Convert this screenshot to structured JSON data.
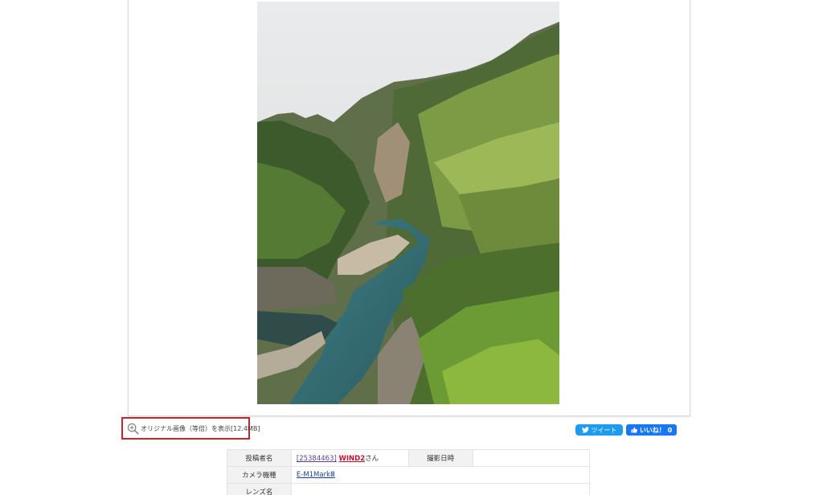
{
  "photo": {
    "description_icon": "landscape-photo"
  },
  "original_link": {
    "label": "オリジナル画像（等倍）を表示[12.4MB]",
    "icon": "zoom-in-icon"
  },
  "social": {
    "tweet_label": "ツイート",
    "like_label": "いいね！ 0"
  },
  "info_table": {
    "poster_header": "投稿者名",
    "poster_id": "[25384463]",
    "poster_name": "WIND2",
    "poster_suffix": "さん",
    "date_header": "撮影日時",
    "date_value": "",
    "camera_header": "カメラ機種",
    "camera_value": "E-M1MarkⅢ",
    "lens_header": "レンズ名",
    "lens_value": ""
  },
  "colors": {
    "highlight_border": "#d0202a",
    "tweet_bg": "#1d9bf0",
    "like_bg": "#1877f2"
  }
}
